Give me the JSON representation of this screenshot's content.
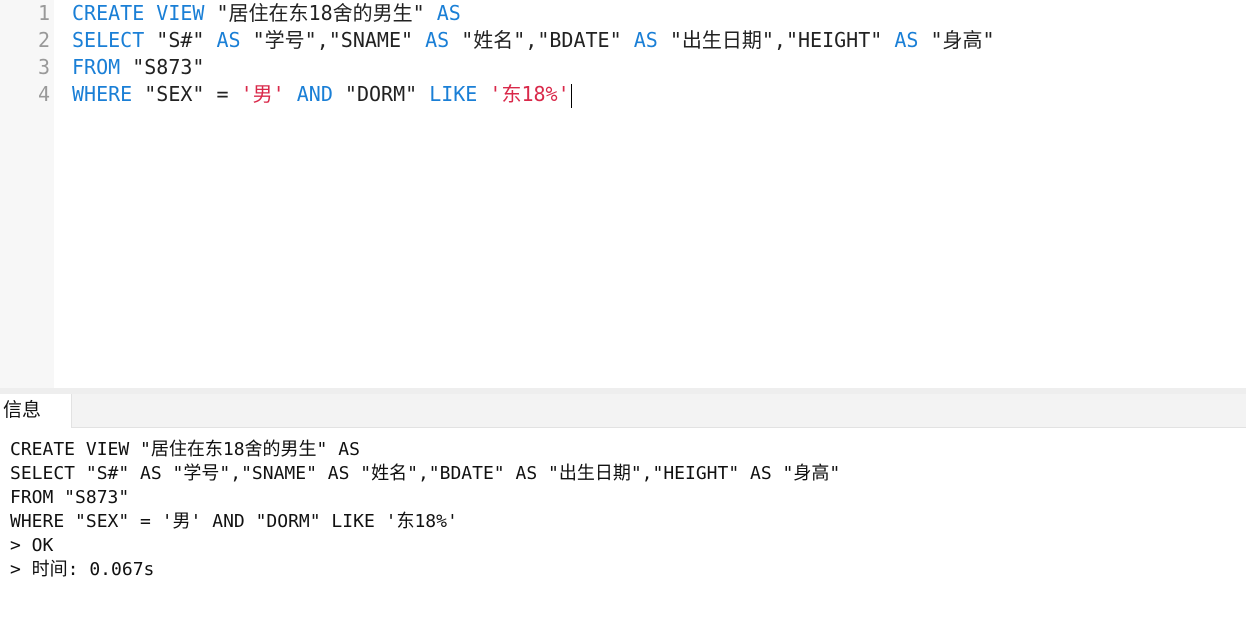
{
  "editor": {
    "line_numbers": [
      "1",
      "2",
      "3",
      "4"
    ],
    "line1": {
      "kw1": "CREATE VIEW",
      "name": " \"居住在东18舍的男生\" ",
      "kw2": "AS"
    },
    "line2": {
      "kw1": "SELECT",
      "c1": " \"S#\" ",
      "kw2": "AS",
      "c2": " \"学号\",\"SNAME\" ",
      "kw3": "AS",
      "c3": " \"姓名\",\"BDATE\" ",
      "kw4": "AS",
      "c4": " \"出生日期\",\"HEIGHT\" ",
      "kw5": "AS",
      "c5": " \"身高\""
    },
    "line3": {
      "kw1": "FROM",
      "table": " \"S873\""
    },
    "line4": {
      "kw1": "WHERE",
      "col1": " \"SEX\" = ",
      "lit1": "'男'",
      "sp": " ",
      "kw2": "AND",
      "col2": " \"DORM\" ",
      "kw3": "LIKE",
      "sp2": " ",
      "lit2": "'东18%'"
    }
  },
  "tabs": {
    "info_label": "信息"
  },
  "output": {
    "lines": [
      "CREATE VIEW \"居住在东18舍的男生\" AS",
      "SELECT \"S#\" AS \"学号\",\"SNAME\" AS \"姓名\",\"BDATE\" AS \"出生日期\",\"HEIGHT\" AS \"身高\"",
      "FROM \"S873\"",
      "WHERE \"SEX\" = '男' AND \"DORM\" LIKE '东18%'",
      "> OK",
      "> 时间: 0.067s"
    ]
  },
  "colors": {
    "keyword": "#1a7fd6",
    "literal": "#d9294a",
    "gutter_bg": "#f7f7f7"
  }
}
